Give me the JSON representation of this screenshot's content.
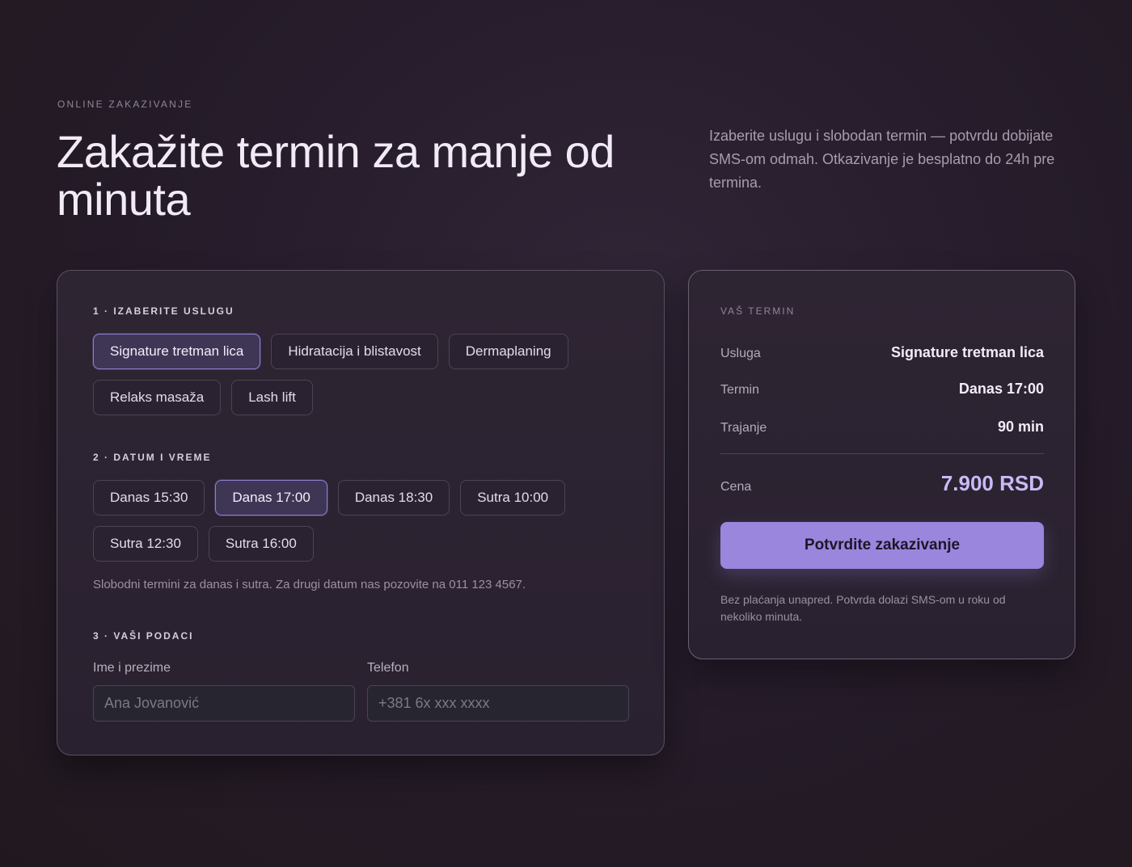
{
  "header": {
    "eyebrow": "ONLINE ZAKAZIVANJE",
    "title": "Zakažite termin za manje od minuta",
    "intro": "Izaberite uslugu i slobodan termin — potvrdu dobijate SMS-om odmah. Otkazivanje je besplatno do 24h pre termina."
  },
  "form": {
    "step1_label": "1 · IZABERITE USLUGU",
    "services": [
      {
        "label": "Signature tretman lica",
        "selected": true
      },
      {
        "label": "Hidratacija i blistavost",
        "selected": false
      },
      {
        "label": "Dermaplaning",
        "selected": false
      },
      {
        "label": "Relaks masaža",
        "selected": false
      },
      {
        "label": "Lash lift",
        "selected": false
      }
    ],
    "step2_label": "2 · DATUM I VREME",
    "slots": [
      {
        "label": "Danas 15:30",
        "selected": false
      },
      {
        "label": "Danas 17:00",
        "selected": true
      },
      {
        "label": "Danas 18:30",
        "selected": false
      },
      {
        "label": "Sutra 10:00",
        "selected": false
      },
      {
        "label": "Sutra 12:30",
        "selected": false
      },
      {
        "label": "Sutra 16:00",
        "selected": false
      }
    ],
    "slots_hint": "Slobodni termini za danas i sutra. Za drugi datum nas pozovite na 011 123 4567.",
    "step3_label": "3 · VAŠI PODACI",
    "name_label": "Ime i prezime",
    "name_placeholder": "Ana Jovanović",
    "phone_label": "Telefon",
    "phone_placeholder": "+381 6x xxx xxxx"
  },
  "summary": {
    "eyebrow": "VAŠ TERMIN",
    "service_key": "Usluga",
    "service_value": "Signature tretman lica",
    "time_key": "Termin",
    "time_value": "Danas 17:00",
    "duration_key": "Trajanje",
    "duration_value": "90 min",
    "price_key": "Cena",
    "price_value": "7.900 RSD",
    "cta_label": "Potvrdite zakazivanje",
    "note": "Bez plaćanja unapred. Potvrda dolazi SMS-om u roku od nekoliko minuta."
  },
  "colors": {
    "accent": "#9a86dd",
    "background": "#241a29"
  }
}
